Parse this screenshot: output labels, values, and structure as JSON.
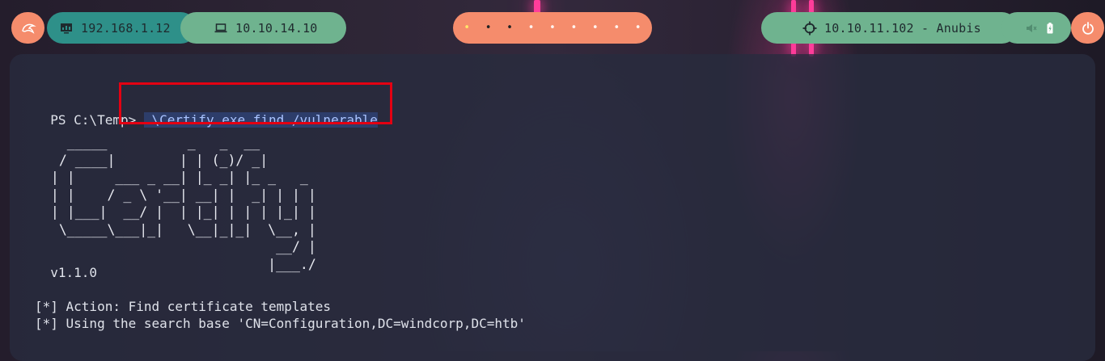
{
  "topbar": {
    "host_ip": "192.168.1.12",
    "vpn_ip": "10.10.14.10",
    "target_label": "10.10.11.102 - Anubis",
    "workspaces": [
      "•",
      "•",
      "•",
      "•",
      "•",
      "•",
      "•",
      "•",
      "•"
    ],
    "active_workspace": 0,
    "colors": {
      "accent_orange": "#f58c6c",
      "teal": "#2e9089",
      "green": "#6fb38f"
    }
  },
  "terminal": {
    "prompt": "PS C:\\Temp>",
    "command": ".\\Certify.exe find /vulnerable",
    "ascii_art": "   _____          _   _  __\n  / ____|        | | (_)/ _|\n | |     ___ _ __| |_ _| |_ _   _\n | |    / _ \\ '__| __| |  _| | | |\n | |___|  __/ |  | |_| | | | |_| |\n  \\_____\\___|_|   \\__|_|_|  \\__, |\n                             __/ |\n                            |___./",
    "version": "  v1.1.0",
    "output_lines": [
      "[*] Action: Find certificate templates",
      "[*] Using the search base 'CN=Configuration,DC=windcorp,DC=htb'"
    ]
  }
}
